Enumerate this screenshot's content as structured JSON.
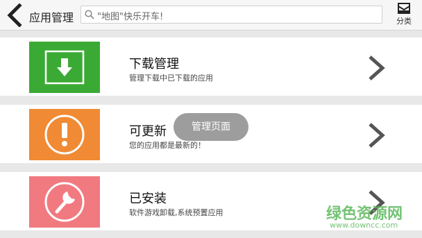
{
  "header": {
    "title": "应用管理",
    "search_placeholder": "\"地图\"快乐开车!",
    "category_label": "分类"
  },
  "rows": [
    {
      "title": "下载管理",
      "subtitle": "管理下载中已下载的应用",
      "icon": "download-icon",
      "color": "#3aaa35"
    },
    {
      "title": "可更新",
      "subtitle": "您的应用都是最新的！",
      "icon": "exclamation-icon",
      "color": "#f08a34"
    },
    {
      "title": "已安装",
      "subtitle": "软件游戏卸载,系统预置应用",
      "icon": "wrench-icon",
      "color": "#f07a80"
    }
  ],
  "toast": {
    "text": "管理页面"
  },
  "watermark": {
    "main": "绿色资源网",
    "url": "www.downcc.com"
  }
}
